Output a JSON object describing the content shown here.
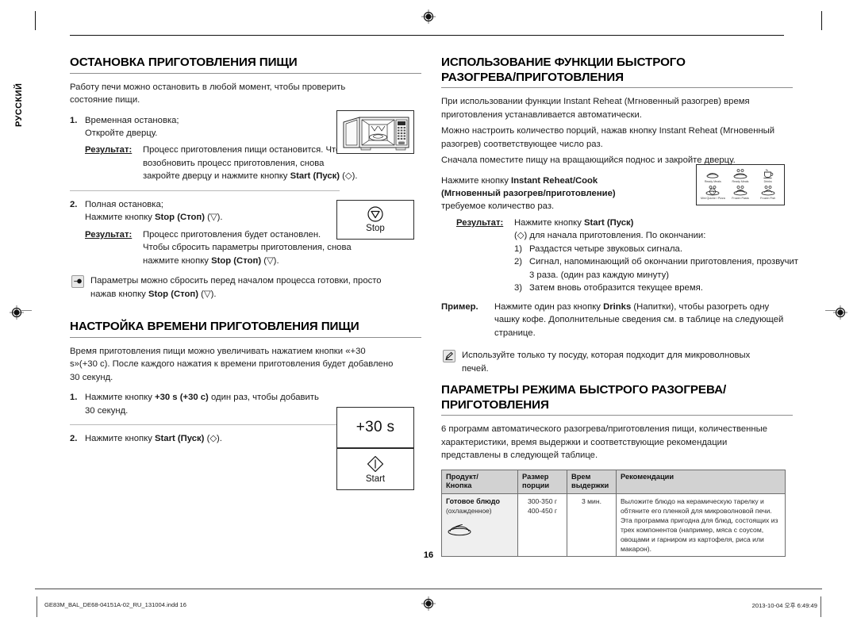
{
  "language_tab": "РУССКИЙ",
  "page_number": "16",
  "left_column": {
    "section1": {
      "heading": "ОСТАНОВКА ПРИГОТОВЛЕНИЯ ПИЩИ",
      "intro": "Работу печи можно остановить в любой момент, чтобы проверить состояние пищи.",
      "step1": {
        "num": "1.",
        "line1": "Временная остановка;",
        "line2": "Откройте дверцу.",
        "result_label": "Результат:",
        "result_text": "Процесс приготовления пищи остановится. Чтобы возобновить процесс приготовления, снова закройте дверцу и нажмите кнопку ",
        "result_bold": "Start (Пуск)",
        "result_tail": " (◇)."
      },
      "step2": {
        "num": "2.",
        "line1": "Полная остановка;",
        "line2_pre": "Нажмите кнопку ",
        "line2_bold": "Stop (Стоп)",
        "line2_tail": " (▽).",
        "result_label": "Результат:",
        "result_text1": "Процесс приготовления будет остановлен.",
        "result_text2_pre": "Чтобы сбросить параметры приготовления, снова нажмите кнопку ",
        "result_text2_bold": "Stop (Стоп)",
        "result_text2_tail": " (▽)."
      },
      "note": {
        "icon": "pointing-hand-icon",
        "text_pre": "Параметры можно сбросить перед началом процесса готовки, просто нажав кнопку ",
        "text_bold": "Stop (Стоп)",
        "text_tail": " (▽)."
      },
      "illustration_microwave": "microwave-oven-open-door-illustration",
      "button_stop": {
        "icon": "stop-button-icon",
        "label": "Stop"
      }
    },
    "section2": {
      "heading": "НАСТРОЙКА ВРЕМЕНИ ПРИГОТОВЛЕНИЯ ПИЩИ",
      "intro": "Время приготовления пищи можно увеличивать нажатием кнопки «+30 s»(+30 с). После каждого нажатия к времени приготовления будет добавлено 30 секунд.",
      "step1": {
        "num": "1.",
        "pre": "Нажмите кнопку ",
        "bold": "+30 s (+30 с)",
        "tail": " один раз, чтобы добавить 30 секунд."
      },
      "step2": {
        "num": "2.",
        "pre": "Нажмите кнопку ",
        "bold": "Start (Пуск)",
        "tail": " (◇)."
      },
      "button_plus30": {
        "text": "+30 s"
      },
      "button_start": {
        "icon": "start-button-icon",
        "label": "Start"
      }
    }
  },
  "right_column": {
    "section1": {
      "heading_line1": "ИСПОЛЬЗОВАНИЕ ФУНКЦИИ БЫСТРОГО",
      "heading_line2": "РАЗОГРЕВА/ПРИГОТОВЛЕНИЯ",
      "para1": "При использовании функции Instant Reheat (Мгновенный разогрев) время приготовления устанавливается автоматически.",
      "para2": "Можно настроить количество порций, нажав кнопку Instant Reheat (Мгновенный разогрев) соответствующее число раз.",
      "para3": "Сначала поместите пищу на вращающийся поднос и закройте дверцу.",
      "press_line1_pre": "Нажмите кнопку ",
      "press_line1_bold": "Instant Reheat/Cook",
      "press_line2_bold": "(Мгновенный разогрев/приготовление)",
      "press_line3": "требуемое количество раз.",
      "result_label": "Результат:",
      "result_pre": "Нажмите кнопку ",
      "result_bold": "Start (Пуск)",
      "result_line2": "(◇) для начала приготовления. По окончании:",
      "sublist": [
        {
          "mark": "1)",
          "text": "Раздастся четыре звуковых сигнала."
        },
        {
          "mark": "2)",
          "text": "Сигнал, напоминающий об окончании приготовления, прозвучит 3 раза. (один раз каждую минуту)"
        },
        {
          "mark": "3)",
          "text": "Затем вновь отобразится текущее время."
        }
      ],
      "example_label": "Пример.",
      "example_pre": "Нажмите один раз кнопку ",
      "example_bold": "Drinks",
      "example_tail": " (Напитки), чтобы разогреть одну чашку кофе. Дополнительные сведения см. в таблице на следующей странице.",
      "note": {
        "icon": "note-pen-icon",
        "text": "Используйте только ту посуду, которая подходит для микроволновых печей."
      },
      "icon_panel": [
        {
          "icon": "ready-meals-icon",
          "caption": "Ready Meals"
        },
        {
          "icon": "ready-meals-stack-icon",
          "caption": "Ready Meals"
        },
        {
          "icon": "drinks-cup-icon",
          "caption": "Drinks"
        },
        {
          "icon": "mini-quiche-pizza-icon",
          "caption": "Mini Quiche / Pizza"
        },
        {
          "icon": "frozen-pasta-icon",
          "caption": "Frozen Pasta"
        },
        {
          "icon": "frozen-fish-icon",
          "caption": "Frozen Fish"
        }
      ]
    },
    "section2": {
      "heading_line1": "ПАРАМЕТРЫ РЕЖИМА БЫСТРОГО РАЗОГРЕВА/",
      "heading_line2": "ПРИГОТОВЛЕНИЯ",
      "intro": "6 программ автоматического разогрева/приготовления пищи, количественные характеристики, время выдержки и соответствующие рекомендации представлены в следующей таблице.",
      "table": {
        "headers": [
          "Продукт/\nКнопка",
          "Размер\nпорции",
          "Врем\nвыдержки",
          "Рекомендации"
        ],
        "headers_split": [
          {
            "l1": "Продукт/",
            "l2": "Кнопка"
          },
          {
            "l1": "Размер",
            "l2": "порции"
          },
          {
            "l1": "Врем",
            "l2": "выдержки"
          },
          {
            "l1": "Рекомендации",
            "l2": ""
          }
        ],
        "rows": [
          {
            "product_name": "Готовое блюдо",
            "product_sub": "(охлажденное)",
            "product_icon": "ready-meal-plate-icon",
            "portion_line1": "300-350 г",
            "portion_line2": "400-450 г",
            "standing_time": "3 мин.",
            "recommendation": "Выложите блюдо на керамическую тарелку и обтяните его пленкой для микроволновой печи. Эта программа пригодна для блюд, состоящих из трех компонентов (например, мяса с соусом, овощами и гарниром из картофеля, риса или макарон)."
          }
        ]
      }
    }
  },
  "footer": {
    "left": "GE83M_BAL_DE68-04151A-02_RU_131004.indd   16",
    "right": "2013-10-04   오후 6:49:49"
  },
  "colors": {
    "table_header_bg": "#d2d2d2",
    "table_first_col_bg": "#efefef",
    "rule": "#8d8d8d",
    "text": "#1a1a1a"
  }
}
